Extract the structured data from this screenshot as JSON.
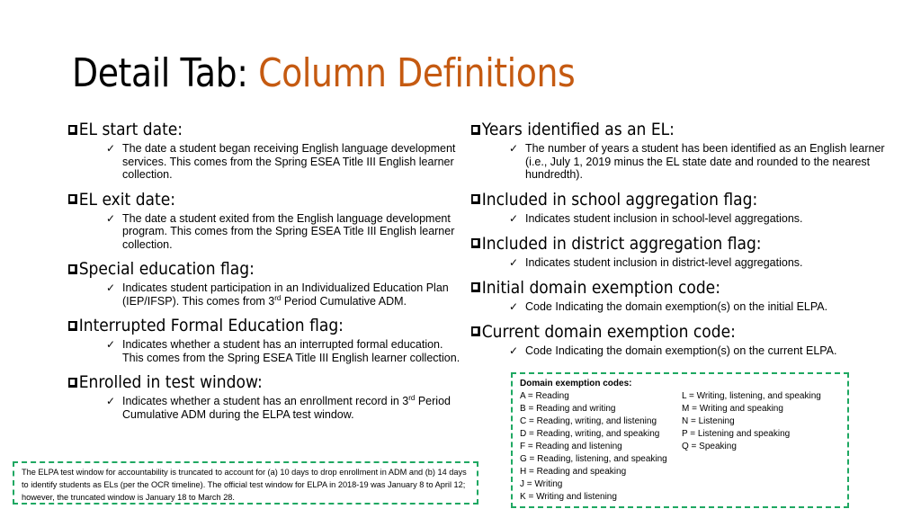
{
  "slide": {
    "title_prefix": "Detail Tab: ",
    "title_accent": "Column Definitions",
    "accent_color": "#c55a11",
    "border_color": "#1fa862"
  },
  "left_items": [
    {
      "heading": "EL start date:",
      "text": "The date a student began receiving English language development services. This comes from the Spring ESEA Title III English learner collection."
    },
    {
      "heading": "EL exit date:",
      "text": "The date a student exited from the English language development program. This comes from the Spring ESEA Title III English learner collection."
    },
    {
      "heading": "Special education flag:",
      "text_before": "Indicates student participation in an Individualized Education Plan (IEP/IFSP). This comes from 3",
      "sup": "rd",
      "text_after": " Period Cumulative ADM."
    },
    {
      "heading": "Interrupted Formal Education flag:",
      "text": "Indicates whether a student has an interrupted formal education. This comes from the Spring ESEA Title III English learner collection."
    },
    {
      "heading": "Enrolled in test window:",
      "text_before": "Indicates whether a student has an enrollment record in 3",
      "sup": "rd",
      "text_after": " Period Cumulative ADM during the ELPA test window."
    }
  ],
  "right_items": [
    {
      "heading": "Years identified as an EL:",
      "text": "The number of years a student has been identified as an English learner (i.e., July 1, 2019 minus the EL state date and rounded to the nearest hundredth)."
    },
    {
      "heading": "Included in school aggregation flag:",
      "text": "Indicates student inclusion in school-level aggregations."
    },
    {
      "heading": "Included in district aggregation flag:",
      "text": "Indicates student inclusion in district-level aggregations."
    },
    {
      "heading": "Initial domain exemption code:",
      "text": "Code Indicating the domain exemption(s) on the initial ELPA."
    },
    {
      "heading": "Current domain exemption code:",
      "text": "Code Indicating the domain exemption(s) on the current ELPA."
    }
  ],
  "note": "The ELPA test window for accountability is truncated to account for (a) 10 days to drop enrollment in ADM and (b) 14 days to identify students as ELs (per the OCR timeline). The official test window for ELPA in 2018-19 was January 8 to April 12; however, the truncated window is January 18 to March 28.",
  "codes": {
    "title": "Domain exemption codes:",
    "col1": [
      "A = Reading",
      "B = Reading and writing",
      "C = Reading, writing, and listening",
      "D = Reading, writing, and speaking",
      "F = Reading and listening",
      "G = Reading, listening, and speaking",
      "H = Reading and speaking",
      "J = Writing",
      "K = Writing and listening"
    ],
    "col2": [
      "L = Writing, listening, and speaking",
      "M = Writing and speaking",
      "N = Listening",
      "P = Listening and speaking",
      "Q = Speaking"
    ]
  }
}
